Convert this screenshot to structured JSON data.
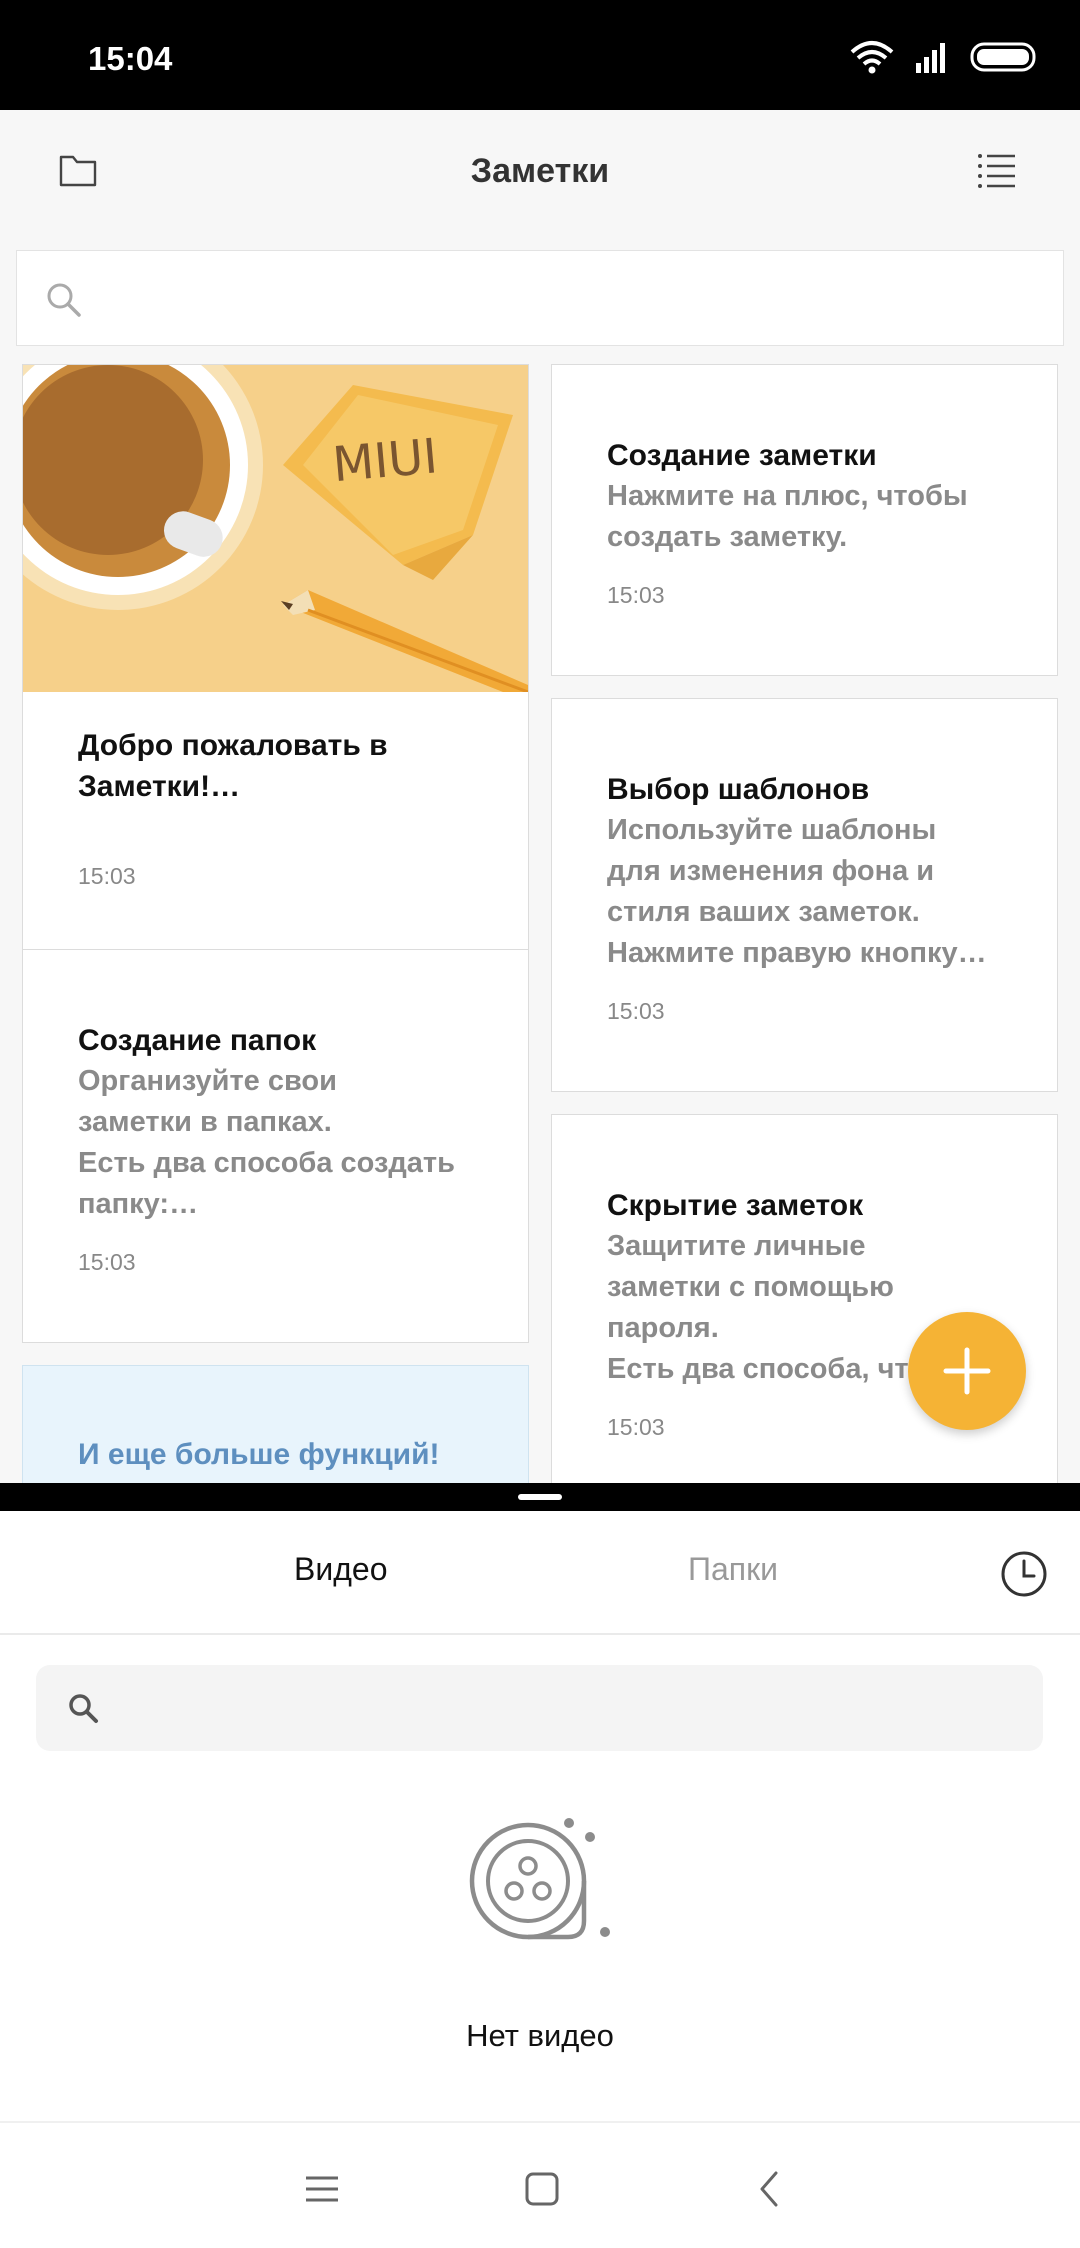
{
  "status_bar": {
    "time": "15:04"
  },
  "notes": {
    "title": "Заметки",
    "cards": [
      {
        "title": "Добро пожаловать в\nЗаметки!…",
        "time": "15:03",
        "illustration_text": "MIUI"
      },
      {
        "title": "Создание заметки",
        "body": "Нажмите на плюс, чтобы\nсоздать заметку.",
        "time": "15:03"
      },
      {
        "title": "Выбор шаблонов",
        "body": "Используйте шаблоны\nдля изменения фона и\nстиля ваших заметок.\nНажмите правую кнопку…",
        "time": "15:03"
      },
      {
        "title": "Создание папок",
        "body": "Организуйте свои\nзаметки в папках.\nЕсть два способа создать\nпапку:…",
        "time": "15:03"
      },
      {
        "title": "Скрытие заметок",
        "body": "Защитите личные\nзаметки с помощью\nпароля.\nЕсть два способа, что",
        "time": "15:03"
      },
      {
        "title": "И еще больше функций!"
      }
    ],
    "accent_color": "#f5b335"
  },
  "video": {
    "tabs": [
      {
        "label": "Видео"
      },
      {
        "label": "Папки"
      }
    ],
    "empty_text": "Нет видео"
  },
  "icons": {
    "folder": "folder-icon",
    "list": "list-icon",
    "search": "search-icon",
    "add": "plus-icon",
    "history": "clock-icon",
    "empty": "film-reel-icon",
    "menu": "menu-icon",
    "home": "home-icon",
    "back": "back-icon"
  }
}
